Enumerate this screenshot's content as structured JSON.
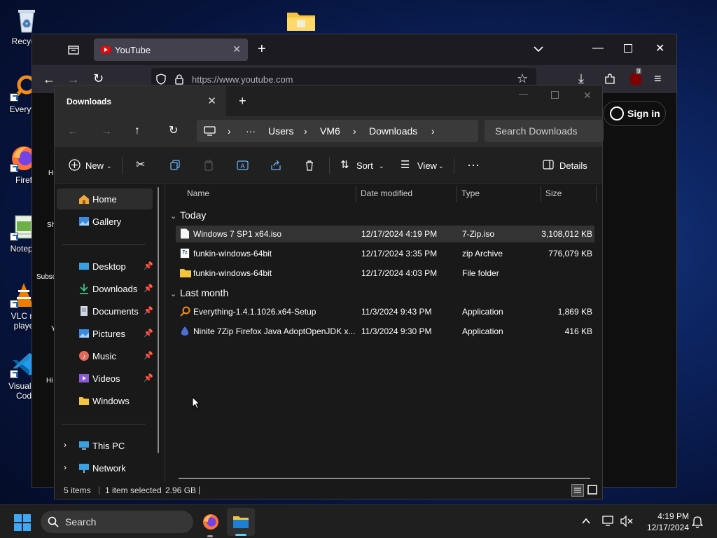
{
  "desktop": {
    "icons": [
      {
        "label": "Recycle"
      },
      {
        "label": "Everyth"
      },
      {
        "label": "Firef"
      },
      {
        "label": "Notepa"
      },
      {
        "label": "VLC m playe"
      },
      {
        "label": "Visual S Cod"
      }
    ]
  },
  "browser": {
    "tab_title": "YouTube",
    "url": "https://www.youtube.com",
    "sign_in": "Sign in",
    "badge_count": "9",
    "peek_labels": [
      "H",
      "Sh",
      "Subsc",
      "Y",
      "Hi"
    ]
  },
  "explorer": {
    "tab_title": "Downloads",
    "breadcrumb": [
      "Users",
      "VM6",
      "Downloads"
    ],
    "search_placeholder": "Search Downloads",
    "toolbar": {
      "new": "New",
      "sort": "Sort",
      "view": "View",
      "details": "Details"
    },
    "nav": {
      "home": "Home",
      "gallery": "Gallery",
      "quick": [
        "Desktop",
        "Downloads",
        "Documents",
        "Pictures",
        "Music",
        "Videos",
        "Windows"
      ],
      "this_pc": "This PC",
      "network": "Network"
    },
    "columns": {
      "name": "Name",
      "date": "Date modified",
      "type": "Type",
      "size": "Size"
    },
    "groups": {
      "today": "Today",
      "last_month": "Last month"
    },
    "rows": [
      {
        "name": "Windows 7 SP1 x64.iso",
        "date": "12/17/2024 4:19 PM",
        "type": "7-Zip.iso",
        "size": "3,108,012 KB"
      },
      {
        "name": "funkin-windows-64bit",
        "date": "12/17/2024 3:35 PM",
        "type": "zip Archive",
        "size": "776,079 KB"
      },
      {
        "name": "funkin-windows-64bit",
        "date": "12/17/2024 4:03 PM",
        "type": "File folder",
        "size": ""
      },
      {
        "name": "Everything-1.4.1.1026.x64-Setup",
        "date": "11/3/2024 9:43 PM",
        "type": "Application",
        "size": "1,869 KB"
      },
      {
        "name": "Ninite 7Zip Firefox Java AdoptOpenJDK x...",
        "date": "11/3/2024 9:30 PM",
        "type": "Application",
        "size": "416 KB"
      }
    ],
    "status": {
      "count": "5 items",
      "selected": "1 item selected",
      "size": "2.96 GB"
    }
  },
  "taskbar": {
    "search": "Search",
    "time": "4:19 PM",
    "date": "12/17/2024"
  },
  "colors": {
    "accent": "#60cdff",
    "folder": "#f3c43c",
    "youtube": "#ff0000"
  }
}
